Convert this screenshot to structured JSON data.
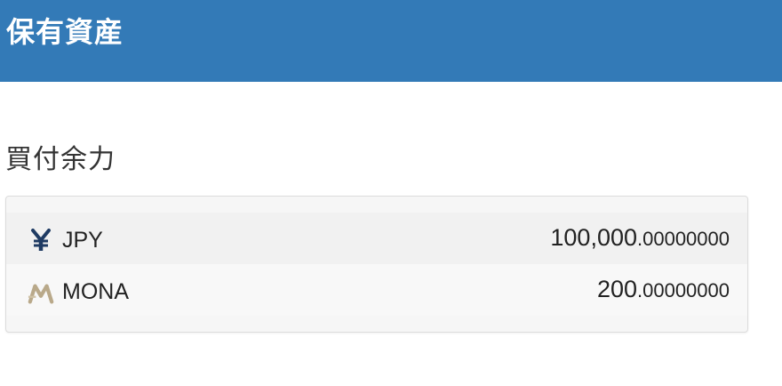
{
  "header": {
    "title": "保有資産"
  },
  "section": {
    "title": "買付余力"
  },
  "balances": [
    {
      "icon": "yen-icon",
      "currency": "JPY",
      "amount_int": "100,000",
      "amount_dec": ".00000000",
      "icon_color": "#1f3b63"
    },
    {
      "icon": "mona-icon",
      "currency": "MONA",
      "amount_int": "200",
      "amount_dec": ".00000000",
      "icon_color": "#b9a98a"
    }
  ],
  "colors": {
    "header_bg": "#337ab7",
    "header_text": "#ffffff"
  }
}
